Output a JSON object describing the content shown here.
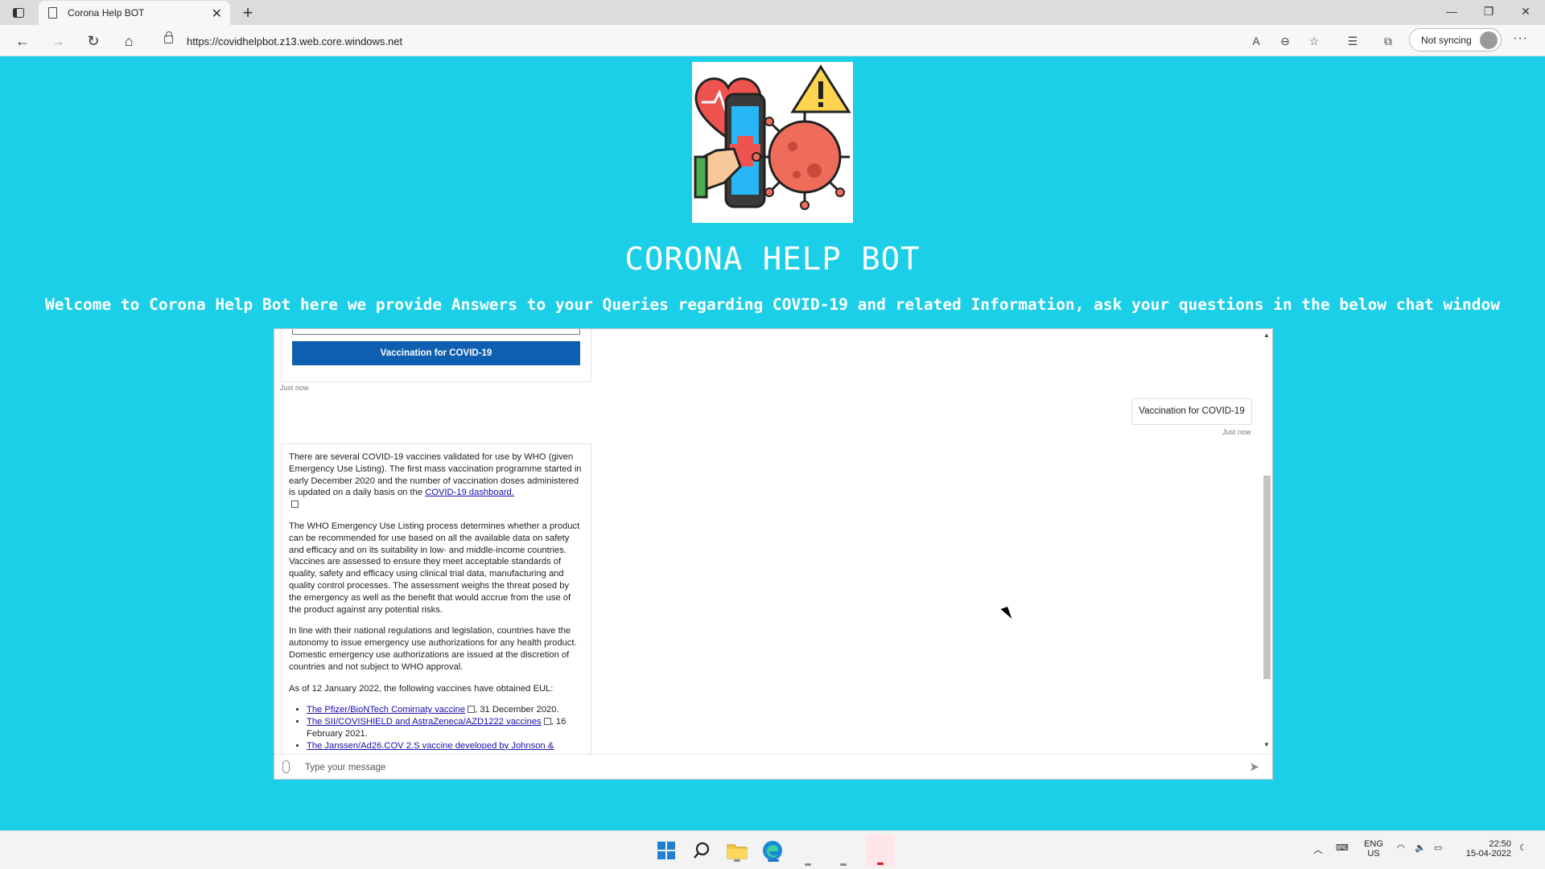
{
  "browser": {
    "tab_title": "Corona Help BOT",
    "url": "https://covidhelpbot.z13.web.core.windows.net",
    "sync_label": "Not syncing"
  },
  "page": {
    "title": "CORONA HELP BOT",
    "subtitle": "Welcome to Corona Help Bot here we provide Answers to your Queries regarding COVID-19 and related Information, ask your questions in the below chat window"
  },
  "chat": {
    "suggestion_button": "Vaccination for COVID-19",
    "timestamp_1": "Just now",
    "user_message": "Vaccination for COVID-19",
    "timestamp_2": "Just now",
    "bot_reply": {
      "p1_text": "There are several COVID-19 vaccines validated for use by WHO (given Emergency Use Listing). The first mass vaccination programme started in early December 2020 and the number of vaccination doses administered is updated on a daily basis on the",
      "p1_link": "COVID-19 dashboard.",
      "p2": "The WHO Emergency Use Listing process determines whether a product can be recommended for use based on all the available data on safety and efficacy and on its suitability in low- and middle-income countries. Vaccines are assessed to ensure they meet acceptable standards of quality, safety and efficacy using clinical trial data, manufacturing and quality control processes. The assessment weighs the threat posed by the emergency as well as the benefit that would accrue from the use of the product against any potential risks.",
      "p3": "In line with their national regulations and legislation, countries have the autonomy to issue emergency use authorizations for any health product.  Domestic emergency use authorizations are issued at the discretion of countries and not subject to WHO approval.",
      "p4": "As of 12 January 2022, the following vaccines have obtained EUL:",
      "list": [
        {
          "link": "The Pfizer/BioNTech Comirnaty vaccine",
          "suffix": ", 31 December 2020."
        },
        {
          "link": "The SII/COVISHIELD and AstraZeneca/AZD1222 vaccines",
          "suffix": ", 16 February 2021."
        },
        {
          "link": "The Janssen/Ad26.COV 2.S vaccine developed by Johnson &",
          "suffix": ""
        }
      ]
    },
    "input_placeholder": "Type your message"
  },
  "taskbar": {
    "lang_1": "ENG",
    "lang_2": "US",
    "time": "22:50",
    "date": "15-04-2022"
  },
  "colors": {
    "page_background": "#1ccfe8",
    "suggestion_button": "#0f5fb0",
    "link": "#1a0dab"
  },
  "icons": [
    "tab-actions-icon",
    "page-icon",
    "close-icon",
    "plus-icon",
    "minimize-icon",
    "restore-icon",
    "back-icon",
    "forward-icon",
    "refresh-icon",
    "home-icon",
    "lock-icon",
    "read-aloud-icon",
    "zoom-out-icon",
    "add-favorite-icon",
    "favorites-icon",
    "collections-icon",
    "more-icon",
    "attach-icon",
    "send-icon",
    "windows-start-icon",
    "search-icon",
    "file-explorer-icon",
    "edge-icon"
  ]
}
